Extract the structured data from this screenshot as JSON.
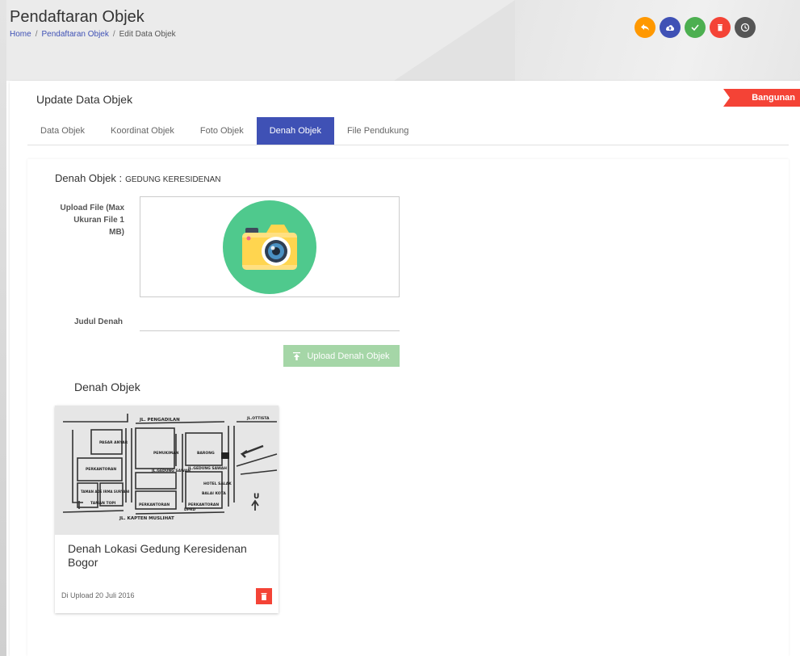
{
  "header": {
    "title": "Pendaftaran Objek",
    "breadcrumb": [
      "Home",
      "Pendaftaran Objek",
      "Edit Data Objek"
    ],
    "breadcrumb_separator": "/",
    "actions": [
      {
        "icon": "reply-icon",
        "color": "#ff9800"
      },
      {
        "icon": "cloud-upload-icon",
        "color": "#3f51b5"
      },
      {
        "icon": "check-icon",
        "color": "#4caf50"
      },
      {
        "icon": "trash-icon",
        "color": "#f44336"
      },
      {
        "icon": "clock-icon",
        "color": "#555555"
      }
    ]
  },
  "card": {
    "title": "Update Data Objek",
    "ribbon": "Bangunan",
    "tabs": [
      {
        "label": "Data Objek",
        "active": false
      },
      {
        "label": "Koordinat Objek",
        "active": false
      },
      {
        "label": "Foto Objek",
        "active": false
      },
      {
        "label": "Denah Objek",
        "active": true
      },
      {
        "label": "File Pendukung",
        "active": false
      }
    ]
  },
  "form": {
    "section_title": "Denah Objek :",
    "section_subtitle": "GEDUNG KERESIDENAN",
    "upload_label": "Upload File (Max Ukuran File 1 MB)",
    "judul_label": "Judul Denah",
    "judul_value": "",
    "upload_button": "Upload Denah Objek"
  },
  "gallery": {
    "heading": "Denah Objek",
    "items": [
      {
        "caption": "Denah Lokasi Gedung Keresidenan Bogor",
        "date": "Di Upload 20 Juli 2016",
        "map_labels": {
          "street_top": "JL. PENGADILAN",
          "street_bottom": "JL. KAPTEN MUSLIHAT",
          "street_mid1": "JL.GEDUNG SAWAH",
          "street_mid2": "JL.GEDUNG SAWAH",
          "street_right": "JL.OTTISTA",
          "block1": "PASAR ANYAR",
          "block2": "PERKANTORAN",
          "block3": "TAMAN ADE IRMA SURYANI",
          "block4": "TAMAN TOPI",
          "block5": "PEMUKIMAN",
          "block6": "PERKANTORAN",
          "block7": "HOTEL SALAK",
          "block8": "BALAI KOTA",
          "block9": "DPRD",
          "block10": "BARONG",
          "block11": "PERKANTORAN",
          "north": "U"
        }
      }
    ]
  },
  "colors": {
    "accent": "#3f51b5",
    "ribbon": "#f44336",
    "upload_button": "#a5d6a7",
    "camera_circle": "#4fc98d",
    "delete": "#f44336"
  }
}
